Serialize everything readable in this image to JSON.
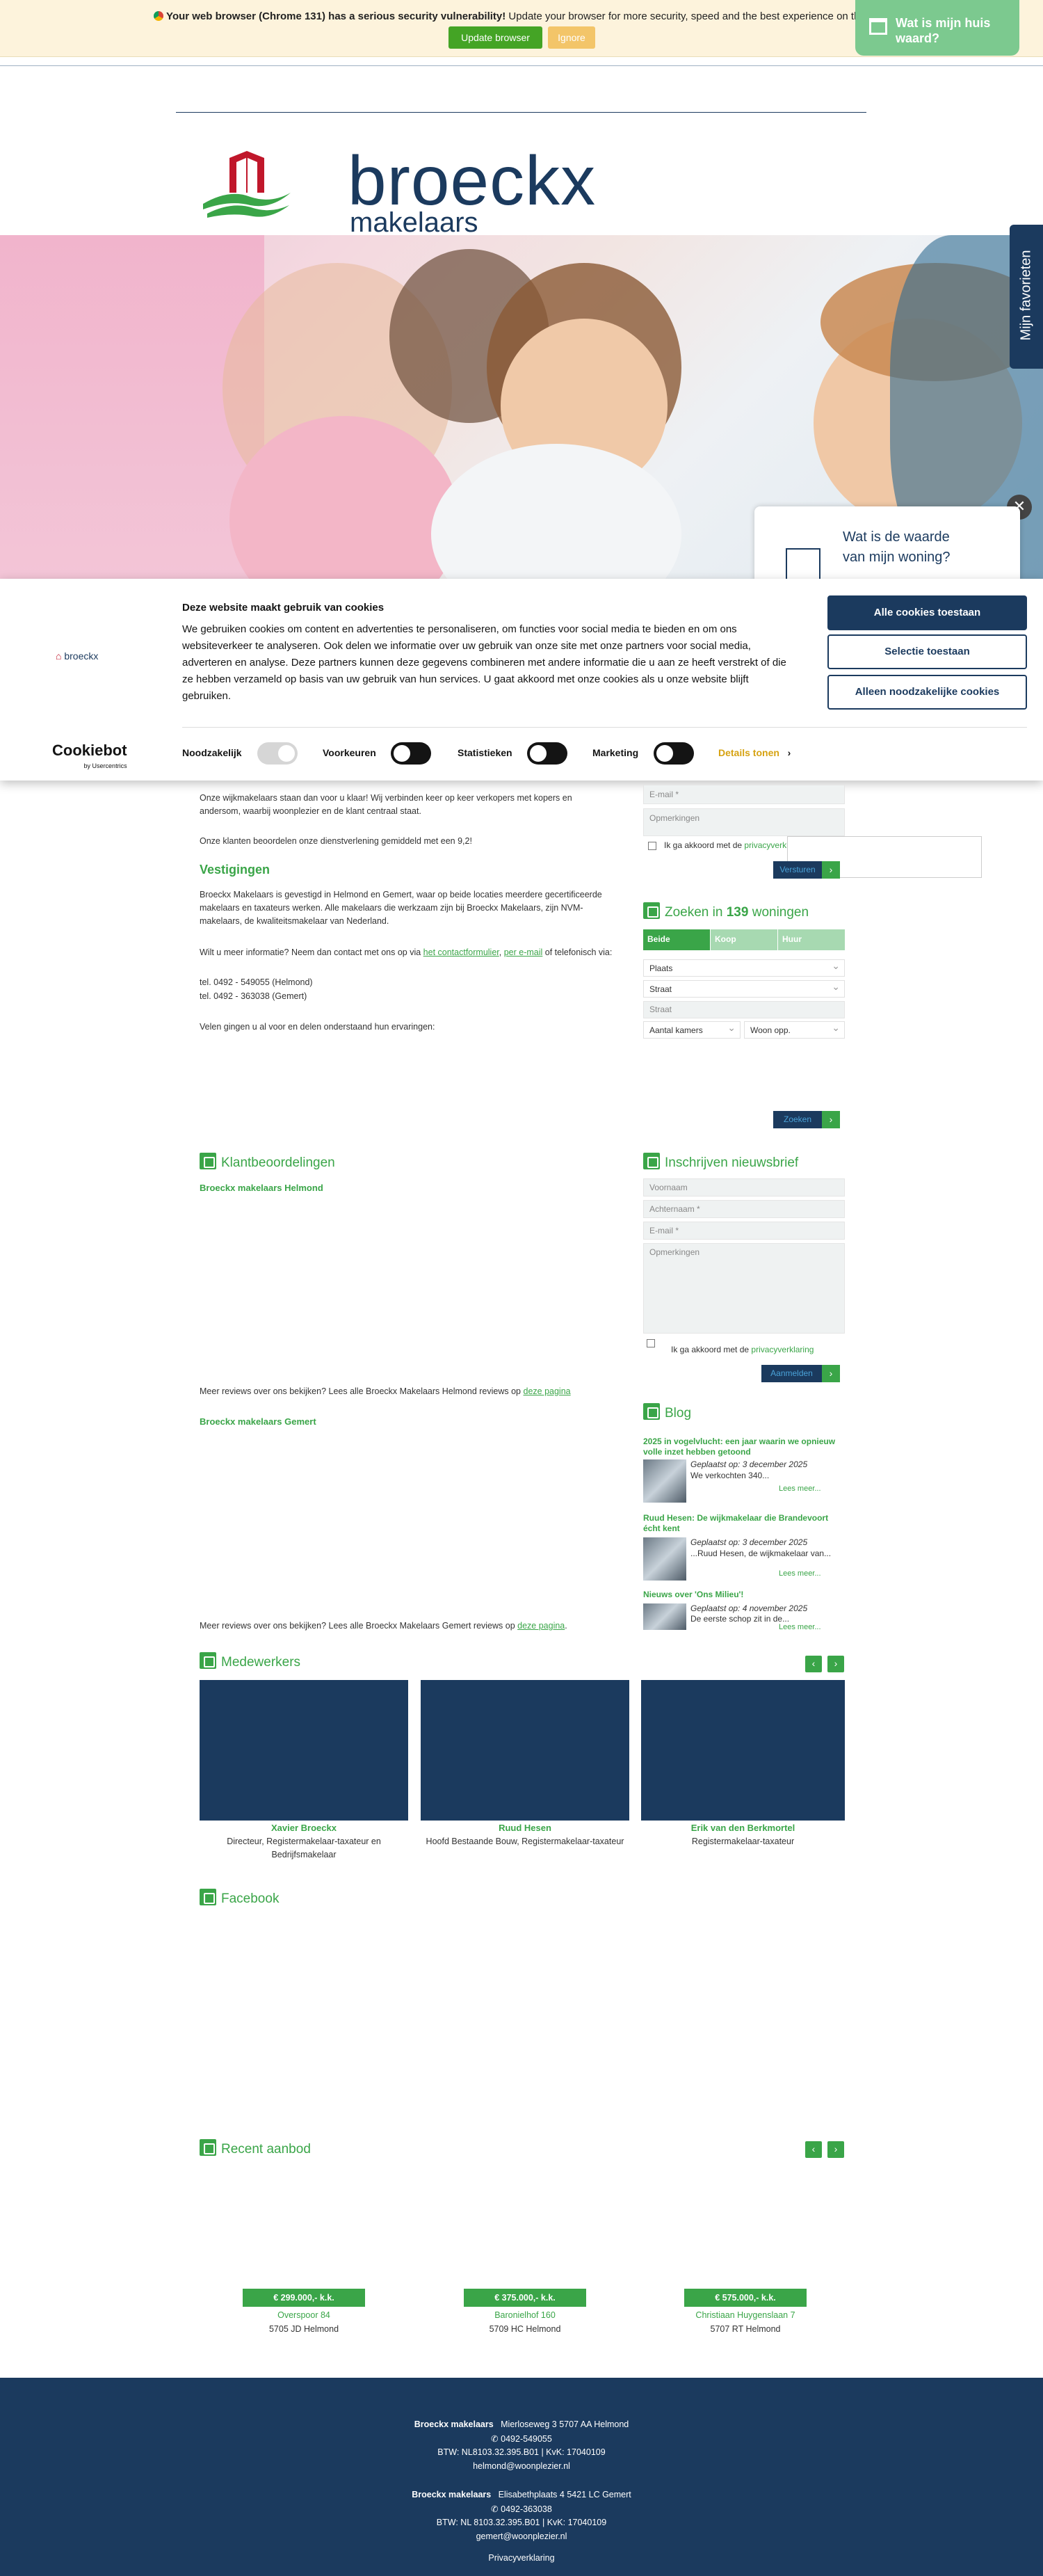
{
  "update_bar": {
    "strong": "Your web browser (Chrome 131) has a serious security vulnerability!",
    "rest": " Update your browser for more security, speed and the best experience on this site.",
    "update_label": "Update browser",
    "ignore_label": "Ignore"
  },
  "float_button": {
    "label": "Wat is mijn huis waard?"
  },
  "logo": {
    "name": "broeckx",
    "sub": "makelaars"
  },
  "favorites": {
    "label": "Mijn favorieten"
  },
  "close": {
    "label": "✕"
  },
  "waarde_popup": {
    "line1": "Wat is de waarde",
    "line2": "van mijn woning?"
  },
  "cookie": {
    "logo": "broeckx",
    "title": "Deze website maakt gebruik van cookies",
    "body": "We gebruiken cookies om content en advertenties te personaliseren, om functies voor social media te bieden en om ons websiteverkeer te analyseren. Ook delen we informatie over uw gebruik van onze site met onze partners voor social media, adverteren en analyse. Deze partners kunnen deze gegevens combineren met andere informatie die u aan ze heeft verstrekt of die ze hebben verzameld op basis van uw gebruik van hun services. U gaat akkoord met onze cookies als u onze website blijft gebruiken.",
    "allow_all": "Alle cookies toestaan",
    "allow_selection": "Selectie toestaan",
    "necessary_only": "Alleen noodzakelijke cookies",
    "cookiebot": "Cookiebot",
    "cookiebot_sub": "by Usercentrics",
    "toggles": [
      "Noodzakelijk",
      "Voorkeuren",
      "Statistieken",
      "Marketing"
    ],
    "details": "Details tonen",
    "details_arrow": "›"
  },
  "intro": {
    "p1": "Onze wijkmakelaars staan dan voor u klaar! Wij verbinden keer op keer verkopers met kopers en andersom, waarbij woonplezier en de klant centraal staat.",
    "p2": "Onze klanten beoordelen onze dienstverlening gemiddeld met een 9,2!"
  },
  "vestigingen": {
    "title": "Vestigingen",
    "p1": "Broeckx Makelaars is gevestigd in Helmond en Gemert, waar op beide locaties meerdere gecertificeerde makelaars en taxateurs werken. Alle makelaars die werkzaam zijn bij Broeckx Makelaars, zijn NVM-makelaars, de kwaliteitsmakelaar van Nederland.",
    "p2_pre": "Wilt u meer informatie? Neem dan contact met ons op via ",
    "contact_link": "het contactformulier",
    "sep": ", ",
    "email_link": "per e-mail",
    "p2_post": " of telefonisch via:",
    "tel1": "tel. 0492 - 549055 (Helmond)",
    "tel2": "tel. 0492 - 363038 (Gemert)",
    "p3": "Velen gingen u al voor en delen onderstaand hun ervaringen:"
  },
  "contact_form": {
    "email_ph": "E-mail *",
    "remarks_ph": "Opmerkingen",
    "privacy_pre": "Ik ga akkoord met de ",
    "privacy_link": "privacyverklaring",
    "send": "Versturen",
    "arrow": "›"
  },
  "search": {
    "title_pre": "Zoeken in ",
    "count": "139",
    "title_post": " woningen",
    "tabs": [
      "Beide",
      "Koop",
      "Huur"
    ],
    "plaats": "Plaats",
    "straat": "Straat",
    "straat_input_ph": "Straat",
    "kamers": "Aantal kamers",
    "opp": "Woon opp.",
    "search_btn": "Zoeken",
    "arrow": "›"
  },
  "reviews": {
    "title": "Klantbeoordelingen",
    "helmond": "Broeckx makelaars Helmond",
    "helmond_more_pre": "Meer reviews over ons bekijken? Lees alle Broeckx Makelaars Helmond reviews op ",
    "link": "deze pagina",
    "helmond_more_post": "",
    "gemert": "Broeckx makelaars Gemert",
    "gemert_more_pre": "Meer reviews over ons bekijken? Lees alle Broeckx Makelaars Gemert reviews op ",
    "gemert_more_post": "."
  },
  "newsletter": {
    "title": "Inschrijven nieuwsbrief",
    "voornaam": "Voornaam",
    "achternaam": "Achternaam *",
    "email": "E-mail *",
    "opmerkingen": "Opmerkingen",
    "privacy_pre": "Ik ga akkoord met de ",
    "privacy_link": "privacyverklaring",
    "submit": "Aanmelden",
    "arrow": "›"
  },
  "blog": {
    "title": "Blog",
    "posts": [
      {
        "title": "2025 in vogelvlucht: een jaar waarin we opnieuw volle inzet hebben getoond",
        "date": "Geplaatst op: 3 december 2025",
        "excerpt": "We verkochten 340...",
        "more": "Lees meer..."
      },
      {
        "title": "Ruud Hesen: De wijkmakelaar die Brandevoort écht kent",
        "date": "Geplaatst op: 3 december 2025",
        "excerpt": "...Ruud Hesen, de wijkmakelaar van...",
        "more": "Lees meer..."
      },
      {
        "title": "Nieuws over 'Ons Milieu'!",
        "date": "Geplaatst op: 4 november 2025",
        "excerpt": "De eerste schop zit in de...",
        "more": "Lees meer..."
      }
    ]
  },
  "medewerkers": {
    "title": "Medewerkers",
    "prev": "‹",
    "next": "›",
    "people": [
      {
        "name": "Xavier Broeckx",
        "role": "Directeur, Registermakelaar-taxateur en Bedrijfsmakelaar"
      },
      {
        "name": "Ruud Hesen",
        "role": "Hoofd Bestaande Bouw, Registermakelaar-taxateur"
      },
      {
        "name": "Erik van den Berkmortel",
        "role": "Registermakelaar-taxateur"
      }
    ]
  },
  "facebook": {
    "title": "Facebook"
  },
  "recent": {
    "title": "Recent aanbod",
    "prev": "‹",
    "next": "›",
    "items": [
      {
        "price": "€ 299.000,- k.k.",
        "street": "Overspoor 84",
        "city": "5705 JD Helmond"
      },
      {
        "price": "€ 375.000,- k.k.",
        "street": "Baronielhof 160",
        "city": "5709 HC Helmond"
      },
      {
        "price": "€ 575.000,- k.k.",
        "street": "Christiaan Huygenslaan 7",
        "city": "5707 RT Helmond"
      }
    ]
  },
  "footer": {
    "office1_name": "Broeckx makelaars",
    "office1_addr": "Mierloseweg 3    5707 AA Helmond",
    "office1_phone": "0492-549055",
    "office1_btw": "BTW: NL8103.32.395.B01 | KvK: 17040109",
    "office1_email": "helmond@woonplezier.nl",
    "office2_name": "Broeckx makelaars",
    "office2_addr": "Elisabethplaats 4    5421 LC Gemert",
    "office2_phone": "0492-363038",
    "office2_btw": "BTW: NL 8103.32.395.B01 | KvK: 17040109",
    "office2_email": "gemert@woonplezier.nl",
    "privacy": "Privacyverklaring"
  },
  "colors": {
    "navy": "#1b3a5e",
    "green": "#3aa548",
    "update_green": "#44a425",
    "ignore_yellow": "#f3c569"
  }
}
